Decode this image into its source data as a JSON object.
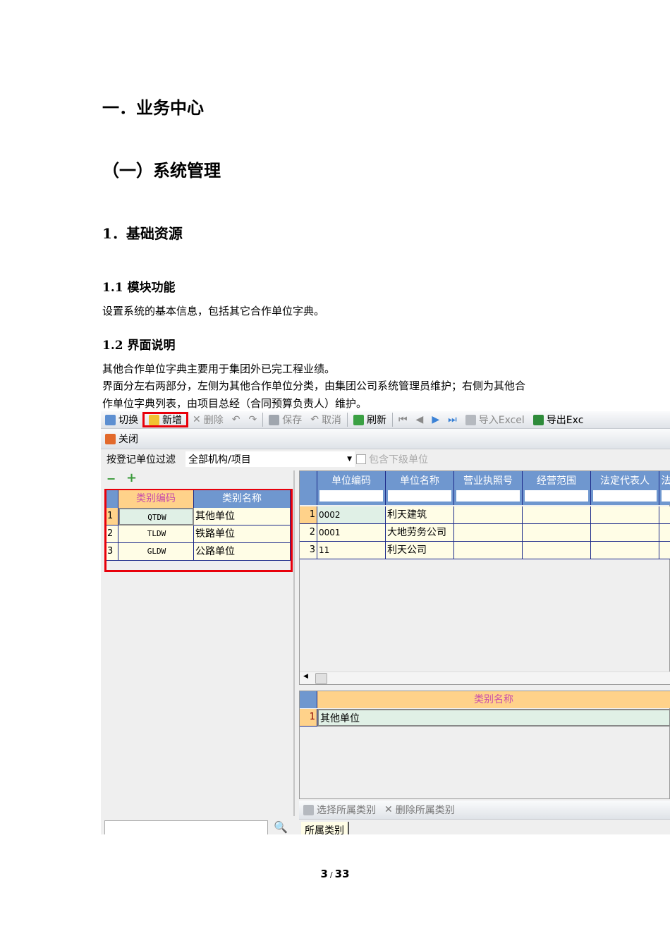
{
  "doc": {
    "h1": "一．业务中心",
    "h2": "（一）系统管理",
    "h3": "1．基础资源",
    "s11": "1.1 模块功能",
    "p11": "设置系统的基本信息，包括其它合作单位字典。",
    "s12": "1.2 界面说明",
    "p12a": "其他合作单位字典主要用于集团外已完工程业绩。",
    "p12b": "界面分左右两部分，左侧为其他合作单位分类，由集团公司系统管理员维护；右侧为其他合",
    "p12c": "作单位字典列表，由项目总经（合同预算负责人）维护。",
    "page": "3",
    "page_sep": "/",
    "pages": "33"
  },
  "toolbar": {
    "switch": "切换",
    "add": "新增",
    "delete": "删除",
    "save": "保存",
    "cancel": "取消",
    "refresh": "刷新",
    "import": "导入Excel",
    "export": "导出Exc",
    "close": "关闭"
  },
  "filter": {
    "label": "按登记单位过滤",
    "value": "全部机构/项目",
    "include_sub": "包含下级单位"
  },
  "left_grid": {
    "headers": [
      "类别编码",
      "类别名称"
    ],
    "rows": [
      [
        "1",
        "QTDW",
        "其他单位"
      ],
      [
        "2",
        "TLDW",
        "铁路单位"
      ],
      [
        "3",
        "GLDW",
        "公路单位"
      ]
    ]
  },
  "right_grid": {
    "headers": [
      "单位编码",
      "单位名称",
      "营业执照号",
      "经营范围",
      "法定代表人",
      "法"
    ],
    "rows": [
      [
        "1",
        "0002",
        "利天建筑"
      ],
      [
        "2",
        "0001",
        "大地劳务公司"
      ],
      [
        "3",
        "11",
        "利天公司"
      ]
    ]
  },
  "lower_grid": {
    "header": "类别名称",
    "rows": [
      [
        "1",
        "其他单位"
      ]
    ]
  },
  "bottom_toolbar": {
    "select": "选择所属类别",
    "remove": "删除所属类别"
  },
  "tab": "所属类别",
  "colors": {
    "header_blue": "#6f97cf",
    "header_orange": "#ffd28a",
    "highlight_red": "#e8000b",
    "row_yellow": "#fffde6"
  }
}
